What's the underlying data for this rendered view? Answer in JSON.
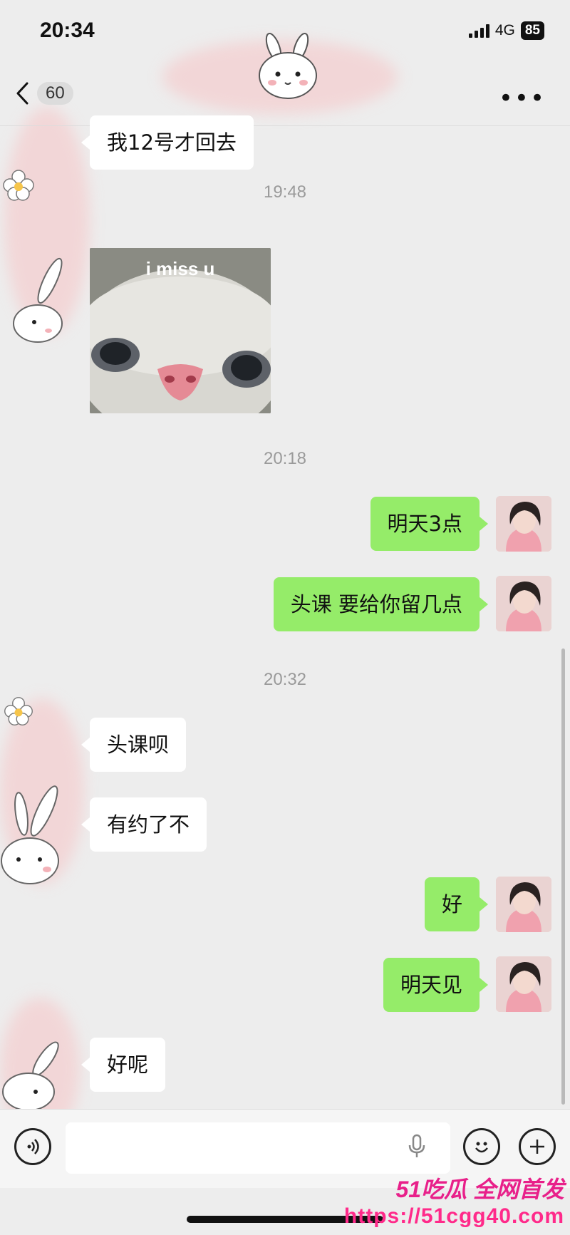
{
  "status_bar": {
    "time": "20:34",
    "network": "4G",
    "battery": "85"
  },
  "nav": {
    "unread_count": "60",
    "more_label": "•••"
  },
  "messages": [
    {
      "text": "我12号才回去"
    },
    {
      "timestamp": "19:48"
    },
    {
      "sticker_caption": "i miss u"
    },
    {
      "timestamp": "20:18"
    },
    {
      "text": "明天3点"
    },
    {
      "text": "头课 要给你留几点"
    },
    {
      "timestamp": "20:32"
    },
    {
      "text": "头课呗"
    },
    {
      "text": "有约了不"
    },
    {
      "text": "好"
    },
    {
      "text": "明天见"
    },
    {
      "text": "好呢"
    }
  ],
  "input_bar": {
    "placeholder": ""
  },
  "watermark": {
    "title": "51吃瓜 全网首发",
    "url": "https://51cgg40.com"
  },
  "colors": {
    "outgoing_bubble": "#95ec69",
    "incoming_bubble": "#ffffff",
    "background": "#ededed",
    "watermark": "#e8208a"
  }
}
